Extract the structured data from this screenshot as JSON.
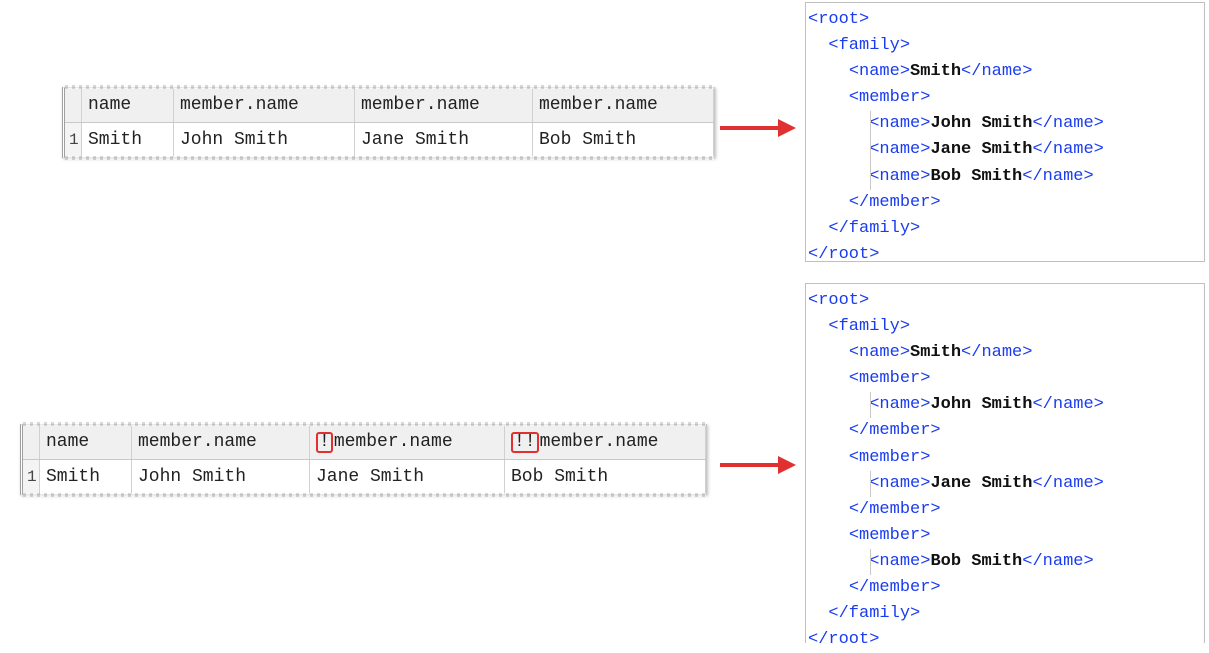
{
  "grid_top": {
    "headers": [
      "name",
      "member.name",
      "member.name",
      "member.name"
    ],
    "row_number": "1",
    "row": [
      "Smith",
      "John Smith",
      "Jane Smith",
      "Bob Smith"
    ]
  },
  "grid_bottom": {
    "headers": [
      "name",
      "member.name",
      "member.name",
      "member.name"
    ],
    "header_prefixes": [
      "",
      "",
      "!",
      "!!"
    ],
    "row_number": "1",
    "row": [
      "Smith",
      "John Smith",
      "Jane Smith",
      "Bob Smith"
    ]
  },
  "xml_top": {
    "root_open": "<root>",
    "family_open": "<family>",
    "name_open": "<name>",
    "name_close": "</name>",
    "family_name": "Smith",
    "member_open": "<member>",
    "members": [
      "John Smith",
      "Jane Smith",
      "Bob Smith"
    ],
    "member_close": "</member>",
    "family_close": "</family>",
    "root_close": "</root>"
  },
  "xml_bottom": {
    "root_open": "<root>",
    "family_open": "<family>",
    "name_open": "<name>",
    "name_close": "</name>",
    "family_name": "Smith",
    "member_open": "<member>",
    "members": [
      "John Smith",
      "Jane Smith",
      "Bob Smith"
    ],
    "member_close": "</member>",
    "family_close": "</family>",
    "root_close": "</root>"
  },
  "colors": {
    "tag": "#1a3cf0",
    "arrow": "#e03030",
    "highlight_box": "#e03030"
  }
}
